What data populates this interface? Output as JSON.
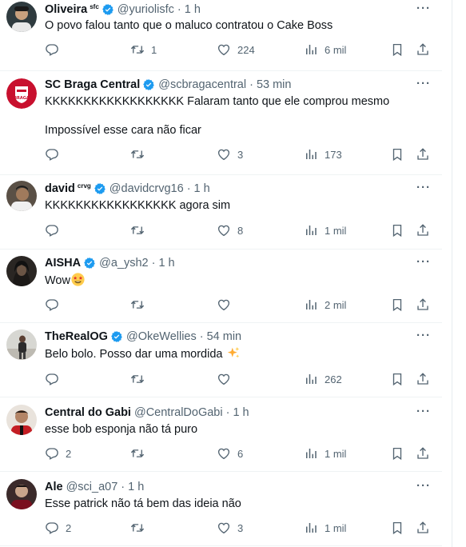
{
  "replies": [
    {
      "name": "Oliveira",
      "badge": "sfc",
      "verified": true,
      "handle": "@yuriolisfc",
      "time": "1 h",
      "lines": [
        "O povo falou tanto que o maluco contratou o Cake Boss"
      ],
      "replies": "",
      "retweets": "1",
      "likes": "224",
      "views": "6 mil"
    },
    {
      "name": "SC Braga Central",
      "badge": "",
      "verified": true,
      "handle": "@scbragacentral",
      "time": "53 min",
      "lines": [
        "KKKKKKKKKKKKKKKKKK Falaram tanto que ele comprou mesmo",
        "",
        "Impossível esse cara não ficar"
      ],
      "avatar_text": "BRAGA",
      "replies": "",
      "retweets": "",
      "likes": "3",
      "views": "173"
    },
    {
      "name": "david",
      "badge": "crvg",
      "verified": true,
      "handle": "@davidcrvg16",
      "time": "1 h",
      "lines": [
        "KKKKKKKKKKKKKKKKK agora sim"
      ],
      "replies": "",
      "retweets": "",
      "likes": "8",
      "views": "1 mil"
    },
    {
      "name": "AISHA",
      "badge": "",
      "verified": true,
      "handle": "@a_ysh2",
      "time": "1 h",
      "lines": [
        "Wow"
      ],
      "emoji": "star-struck",
      "replies": "",
      "retweets": "",
      "likes": "",
      "views": "2 mil"
    },
    {
      "name": "TheRealOG",
      "badge": "",
      "verified": true,
      "handle": "@OkeWellies",
      "time": "54 min",
      "lines": [
        "Belo bolo. Posso dar uma mordida"
      ],
      "emoji": "sparkles",
      "replies": "",
      "retweets": "",
      "likes": "",
      "views": "262"
    },
    {
      "name": "Central do Gabi",
      "badge": "",
      "verified": false,
      "handle": "@CentralDoGabi",
      "time": "1 h",
      "lines": [
        "esse bob esponja não tá puro"
      ],
      "replies": "2",
      "retweets": "",
      "likes": "6",
      "views": "1 mil"
    },
    {
      "name": "Ale",
      "badge": "",
      "verified": false,
      "handle": "@sci_a07",
      "time": "1 h",
      "lines": [
        "Esse patrick não tá bem das ideia não"
      ],
      "replies": "2",
      "retweets": "",
      "likes": "3",
      "views": "1 mil"
    }
  ],
  "colors": {
    "text": "#0f1419",
    "muted": "#536471",
    "verified": "#1d9bf0",
    "divider": "#eff3f4"
  }
}
